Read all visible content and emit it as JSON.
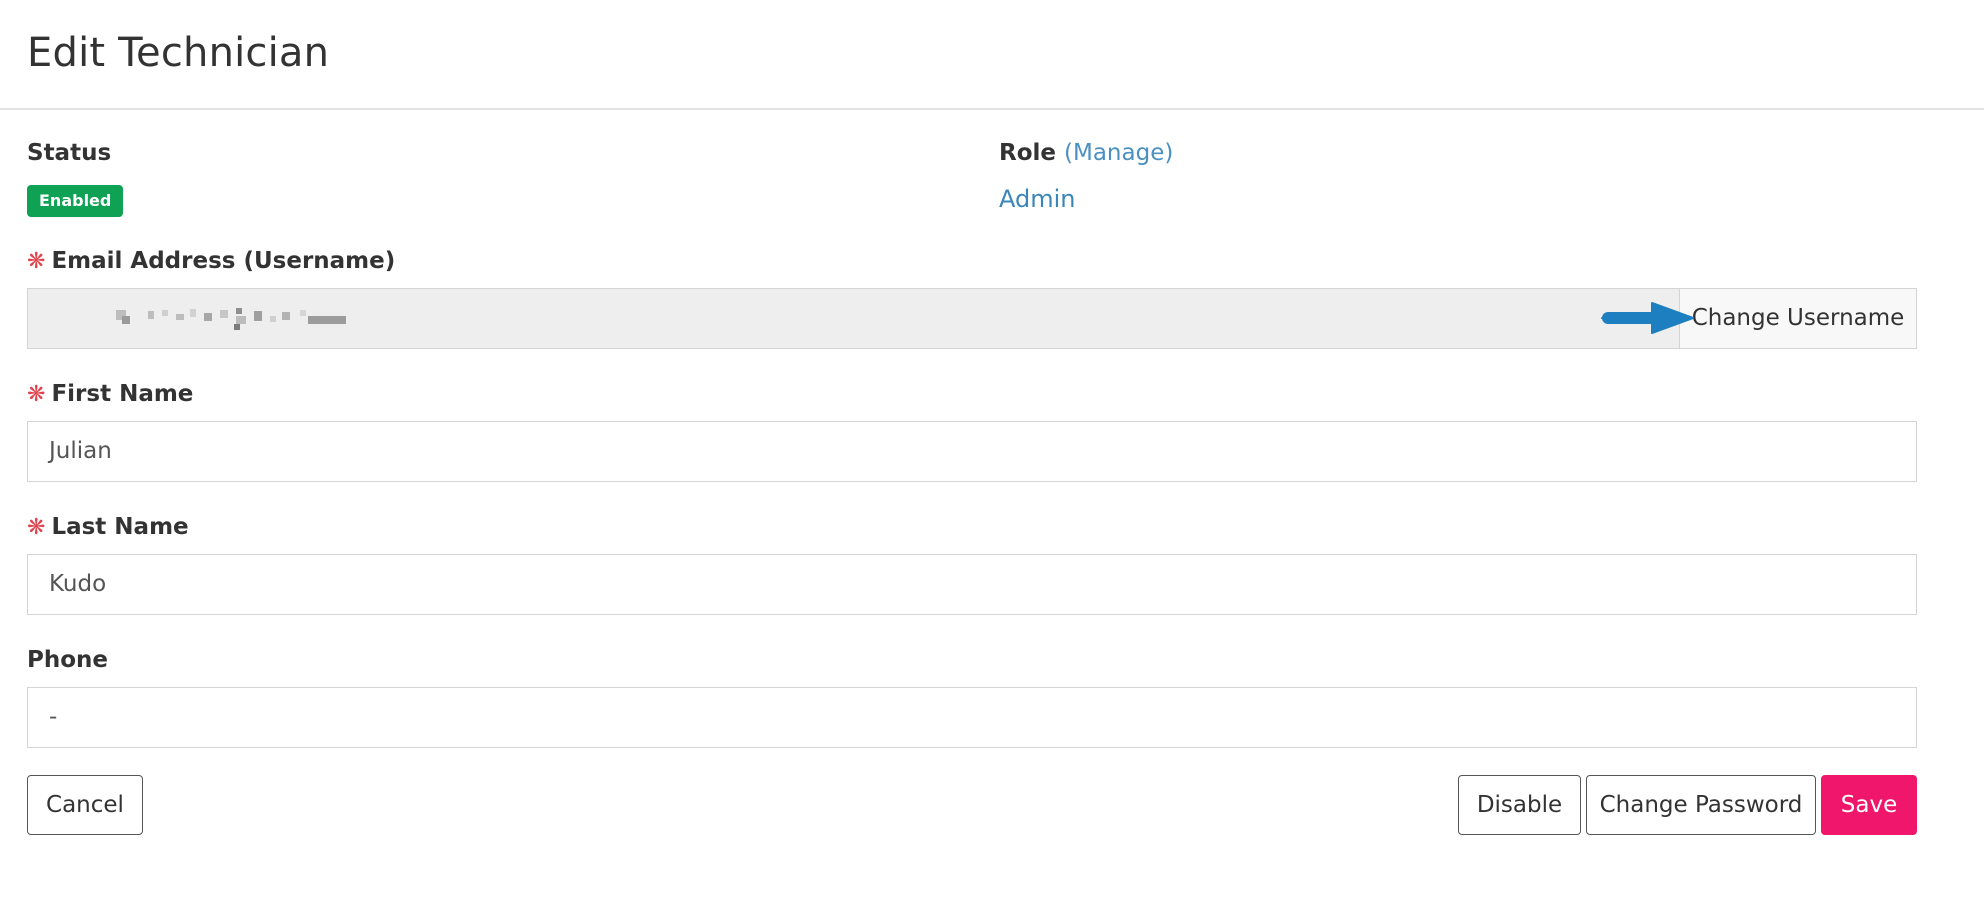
{
  "page": {
    "title": "Edit Technician"
  },
  "status": {
    "label": "Status",
    "badge": "Enabled",
    "badge_color": "#10a254"
  },
  "role": {
    "label": "Role",
    "manage_link": "(Manage)",
    "value": "Admin"
  },
  "email": {
    "label": "Email Address (Username)",
    "required": "❋",
    "change_button": "Change Username"
  },
  "first_name": {
    "label": "First Name",
    "required": "❋",
    "value": "Julian"
  },
  "last_name": {
    "label": "Last Name",
    "required": "❋",
    "value": "Kudo"
  },
  "phone": {
    "label": "Phone",
    "value": "-"
  },
  "actions": {
    "cancel": "Cancel",
    "disable": "Disable",
    "change_password": "Change Password",
    "save": "Save"
  },
  "colors": {
    "save": "#f0166b",
    "accent_link": "#3a86b8",
    "required": "#e0444f",
    "callout_arrow": "#1e7fc0"
  },
  "icons": {
    "callout": "arrow-right-icon",
    "required": "asterisk-icon"
  }
}
